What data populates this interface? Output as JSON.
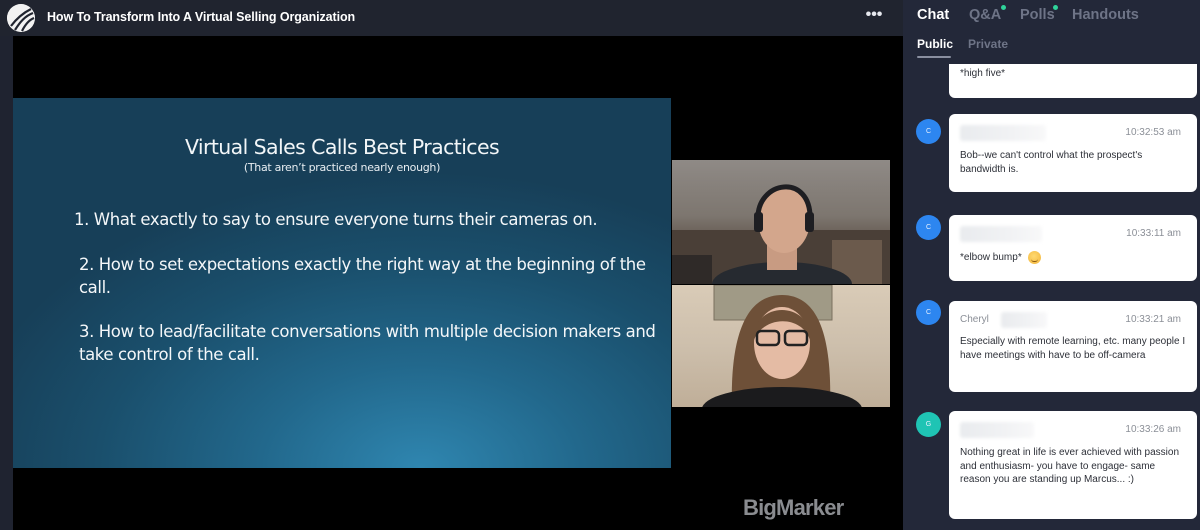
{
  "header": {
    "logo": "bigmarker-logo-icon",
    "title": "How To Transform Into A Virtual Selling Organization",
    "more_icon": "more-horizontal-icon",
    "more_label": "•••"
  },
  "slide": {
    "title": "Virtual Sales Calls Best Practices",
    "subtitle": "(That aren’t practiced nearly enough)",
    "items": [
      "1.  What exactly to say to ensure everyone turns their cameras on.",
      "2. How to set expectations exactly the right way at the beginning of the call.",
      "3. How to lead/facilitate conversations with multiple decision makers and take control of the call."
    ]
  },
  "cameras": [
    {
      "label": "presenter-webcam-male"
    },
    {
      "label": "presenter-webcam-female"
    }
  ],
  "watermark": "BigMarker",
  "panel": {
    "tabs": [
      {
        "label": "Chat",
        "active": true,
        "badge": false
      },
      {
        "label": "Q&A",
        "active": false,
        "badge": true
      },
      {
        "label": "Polls",
        "active": false,
        "badge": true
      },
      {
        "label": "Handouts",
        "active": false,
        "badge": false
      }
    ],
    "subtabs": [
      {
        "label": "Public",
        "active": true
      },
      {
        "label": "Private",
        "active": false
      }
    ],
    "badge_color": "#2fd39a",
    "messages": [
      {
        "avatar": "",
        "name": "",
        "time": "",
        "text": "*high five*",
        "partial": true
      },
      {
        "avatar": "C",
        "avatar_color": "#2d86f0",
        "name": "",
        "time": "10:32:53 am",
        "text": "Bob--we can't control what the prospect's bandwidth is."
      },
      {
        "avatar": "C",
        "avatar_color": "#2d86f0",
        "name": "",
        "time": "10:33:11 am",
        "text": "*elbow bump*",
        "emoji": "smirking-face-emoji"
      },
      {
        "avatar": "C",
        "avatar_color": "#2d86f0",
        "name": "Cheryl",
        "time": "10:33:21 am",
        "text": "Especially with remote learning, etc. many people I have meetings with have to be off-camera"
      },
      {
        "avatar": "G",
        "avatar_color": "#1fc4b4",
        "name": "",
        "time": "10:33:26 am",
        "text": "Nothing great in life is ever achieved with passion and enthusiasm- you have to engage- same reason you are standing up Marcus... :)"
      }
    ]
  }
}
